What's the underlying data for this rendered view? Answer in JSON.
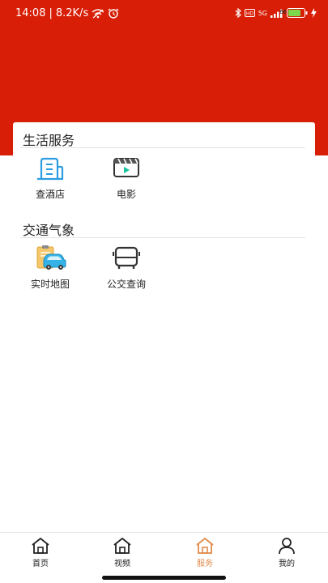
{
  "status_bar": {
    "time": "14:08",
    "separator": "|",
    "speed": "8.2K/s",
    "network": "5G",
    "battery": "66"
  },
  "sections": [
    {
      "title": "生活服务",
      "items": [
        {
          "label": "查酒店",
          "icon": "hotel-building-icon"
        },
        {
          "label": "电影",
          "icon": "movie-player-icon"
        }
      ]
    },
    {
      "title": "交通气象",
      "items": [
        {
          "label": "实时地图",
          "icon": "car-clipboard-icon"
        },
        {
          "label": "公交查询",
          "icon": "bus-icon"
        }
      ]
    }
  ],
  "bottom_nav": {
    "tabs": [
      {
        "label": "首页",
        "icon": "home-icon",
        "active": false
      },
      {
        "label": "视频",
        "icon": "home-icon",
        "active": false
      },
      {
        "label": "服务",
        "icon": "home-icon",
        "active": true
      },
      {
        "label": "我的",
        "icon": "person-icon",
        "active": false
      }
    ]
  },
  "colors": {
    "brand_red": "#d81e06",
    "icon_blue": "#2b9de0",
    "active_orange": "#e08a4a"
  }
}
